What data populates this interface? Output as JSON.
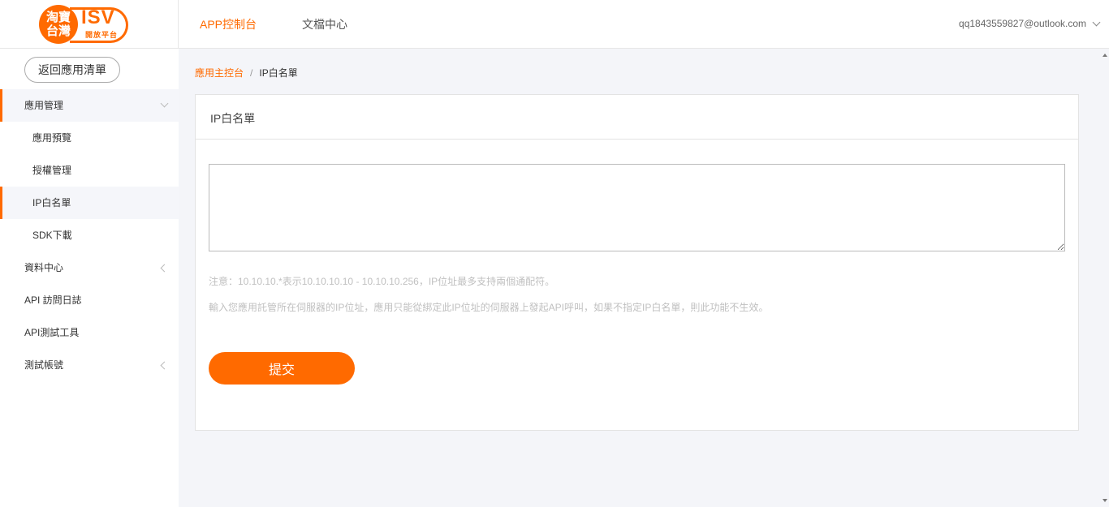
{
  "header": {
    "logo": {
      "brand_top": "淘寶",
      "brand_bottom": "台灣",
      "isv": "ISV",
      "sub": "開放平台"
    },
    "tabs": [
      {
        "label": "APP控制台",
        "active": true
      },
      {
        "label": "文檔中心",
        "active": false
      }
    ],
    "user_email": "qq1843559827@outlook.com"
  },
  "sidebar": {
    "back_label": "返回應用清單",
    "items": [
      {
        "label": "應用管理",
        "type": "group",
        "expanded": true
      },
      {
        "label": "應用預覽",
        "type": "sub"
      },
      {
        "label": "授權管理",
        "type": "sub"
      },
      {
        "label": "IP白名單",
        "type": "sub",
        "active": true
      },
      {
        "label": "SDK下載",
        "type": "sub"
      },
      {
        "label": "資料中心",
        "type": "group",
        "expanded": false
      },
      {
        "label": "API 訪問日誌",
        "type": "item"
      },
      {
        "label": "API測試工具",
        "type": "item"
      },
      {
        "label": "測試帳號",
        "type": "group",
        "expanded": false
      }
    ]
  },
  "breadcrumb": {
    "parent": "應用主控台",
    "separator": "/",
    "current": "IP白名單"
  },
  "panel": {
    "title": "IP白名單",
    "textarea_value": "",
    "note1": "注意：10.10.10.*表示10.10.10.10 - 10.10.10.256，IP位址最多支持兩個通配符。",
    "note2": "輸入您應用託管所在伺服器的IP位址，應用只能從綁定此IP位址的伺服器上發起API呼叫，如果不指定IP白名單，則此功能不生效。",
    "submit_label": "提交"
  },
  "colors": {
    "accent": "#ff6a00"
  }
}
